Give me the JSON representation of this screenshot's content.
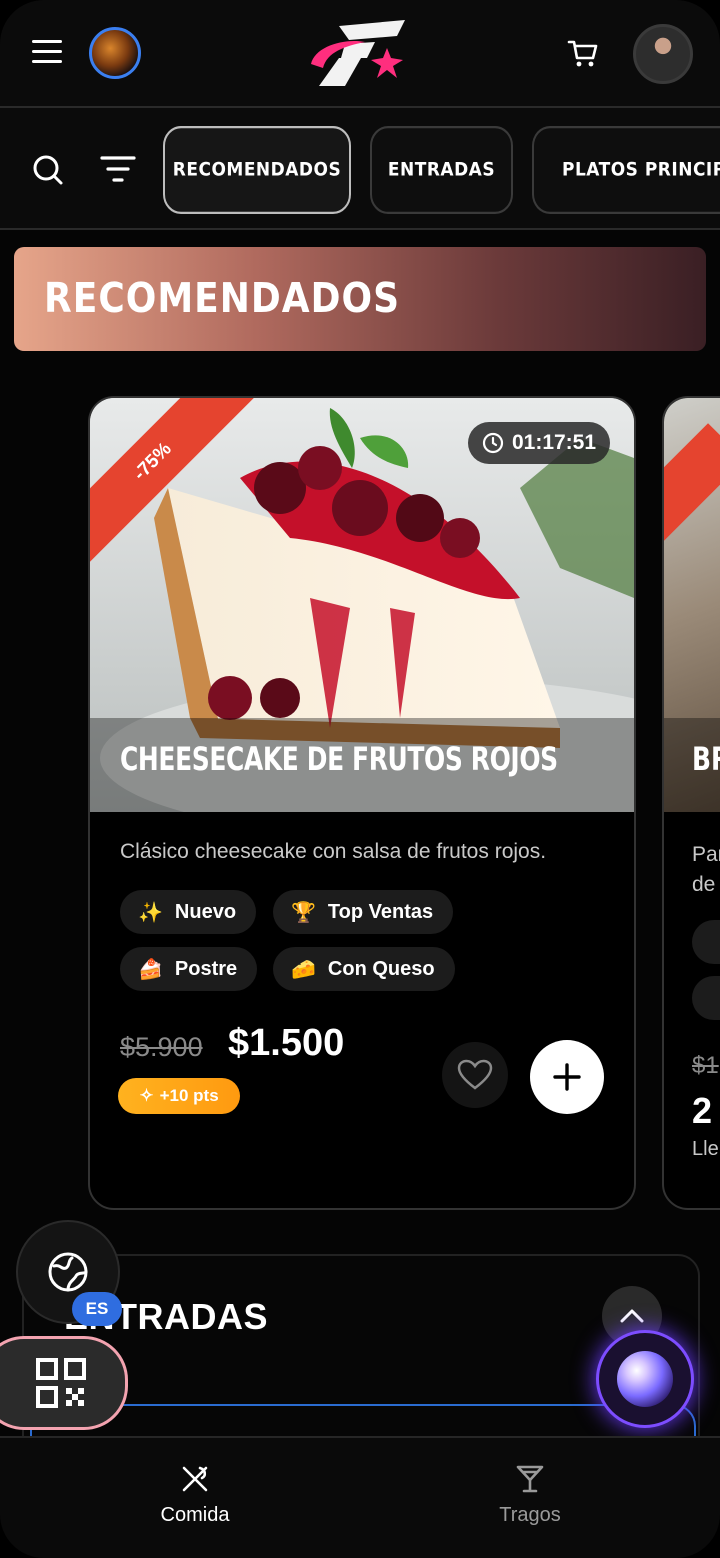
{
  "header": {
    "menu_icon": "hamburger-icon",
    "planet_icon": "planet-avatar",
    "logo": "brand-logo",
    "cart_icon": "cart-icon",
    "user_avatar": "user-avatar"
  },
  "filterbar": {
    "search_icon": "search-icon",
    "filter_icon": "filter-icon",
    "categories": [
      "RECOMENDADOS",
      "ENTRADAS",
      "PLATOS PRINCIPA"
    ],
    "active_category": "RECOMENDADOS"
  },
  "section": {
    "title": "RECOMENDADOS"
  },
  "card": {
    "discount": "-75%",
    "timer": "01:17:51",
    "title": "CHEESECAKE DE FRUTOS ROJOS",
    "description": "Clásico cheesecake con salsa de frutos rojos.",
    "tags": [
      {
        "emoji": "✨",
        "label": "Nuevo"
      },
      {
        "emoji": "🏆",
        "label": "Top Ventas"
      },
      {
        "emoji": "🍰",
        "label": "Postre"
      },
      {
        "emoji": "🧀",
        "label": "Con Queso"
      }
    ],
    "old_price": "$5.900",
    "price": "$1.500",
    "points": "+10 pts"
  },
  "card2": {
    "title": "BR",
    "description_line1": "Par",
    "description_line2": "de",
    "old_price": "$1",
    "price": "2",
    "subtitle": "Lle"
  },
  "entradas": {
    "title": "ENTRADAS"
  },
  "floating": {
    "language": "ES"
  },
  "bottomnav": {
    "food_label": "Comida",
    "drinks_label": "Tragos"
  },
  "colors": {
    "accent_blue": "#2f6de0",
    "discount_red": "#e5442f",
    "points_orange": "#ffb21f",
    "logo_pink": "#ff2e7e"
  }
}
